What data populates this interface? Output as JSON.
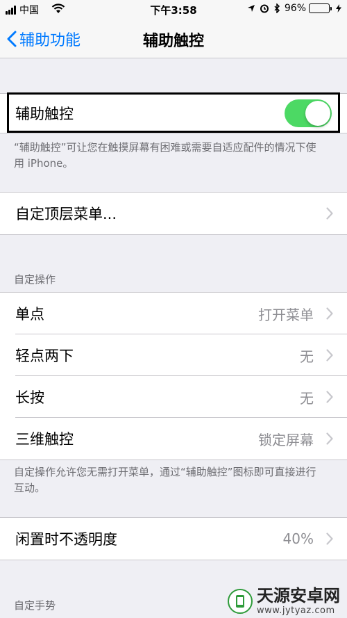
{
  "status_bar": {
    "carrier": "中国",
    "time": "下午3:58",
    "battery_percent": "96%",
    "battery_level": 0.96
  },
  "nav": {
    "back_label": "辅助功能",
    "title": "辅助触控"
  },
  "main_toggle": {
    "label": "辅助触控",
    "on": true,
    "footer": "“辅助触控”可让您在触摸屏幕有困难或需要自适应配件的情况下使用 iPhone。"
  },
  "top_menu": {
    "label": "自定顶层菜单..."
  },
  "custom_actions": {
    "header": "自定操作",
    "items": [
      {
        "label": "单点",
        "value": "打开菜单"
      },
      {
        "label": "轻点两下",
        "value": "无"
      },
      {
        "label": "长按",
        "value": "无"
      },
      {
        "label": "三维触控",
        "value": "锁定屏幕"
      }
    ],
    "footer": "自定操作允许您无需打开菜单，通过“辅助触控”图标即可直接进行互动。"
  },
  "idle_opacity": {
    "label": "闲置时不透明度",
    "value": "40%"
  },
  "custom_gestures": {
    "header": "自定手势"
  },
  "watermark": {
    "name": "天源安卓网",
    "url": "www.jytyaz.com"
  },
  "colors": {
    "accent": "#007aff",
    "toggle_on": "#4cd964",
    "background": "#efeff4"
  }
}
